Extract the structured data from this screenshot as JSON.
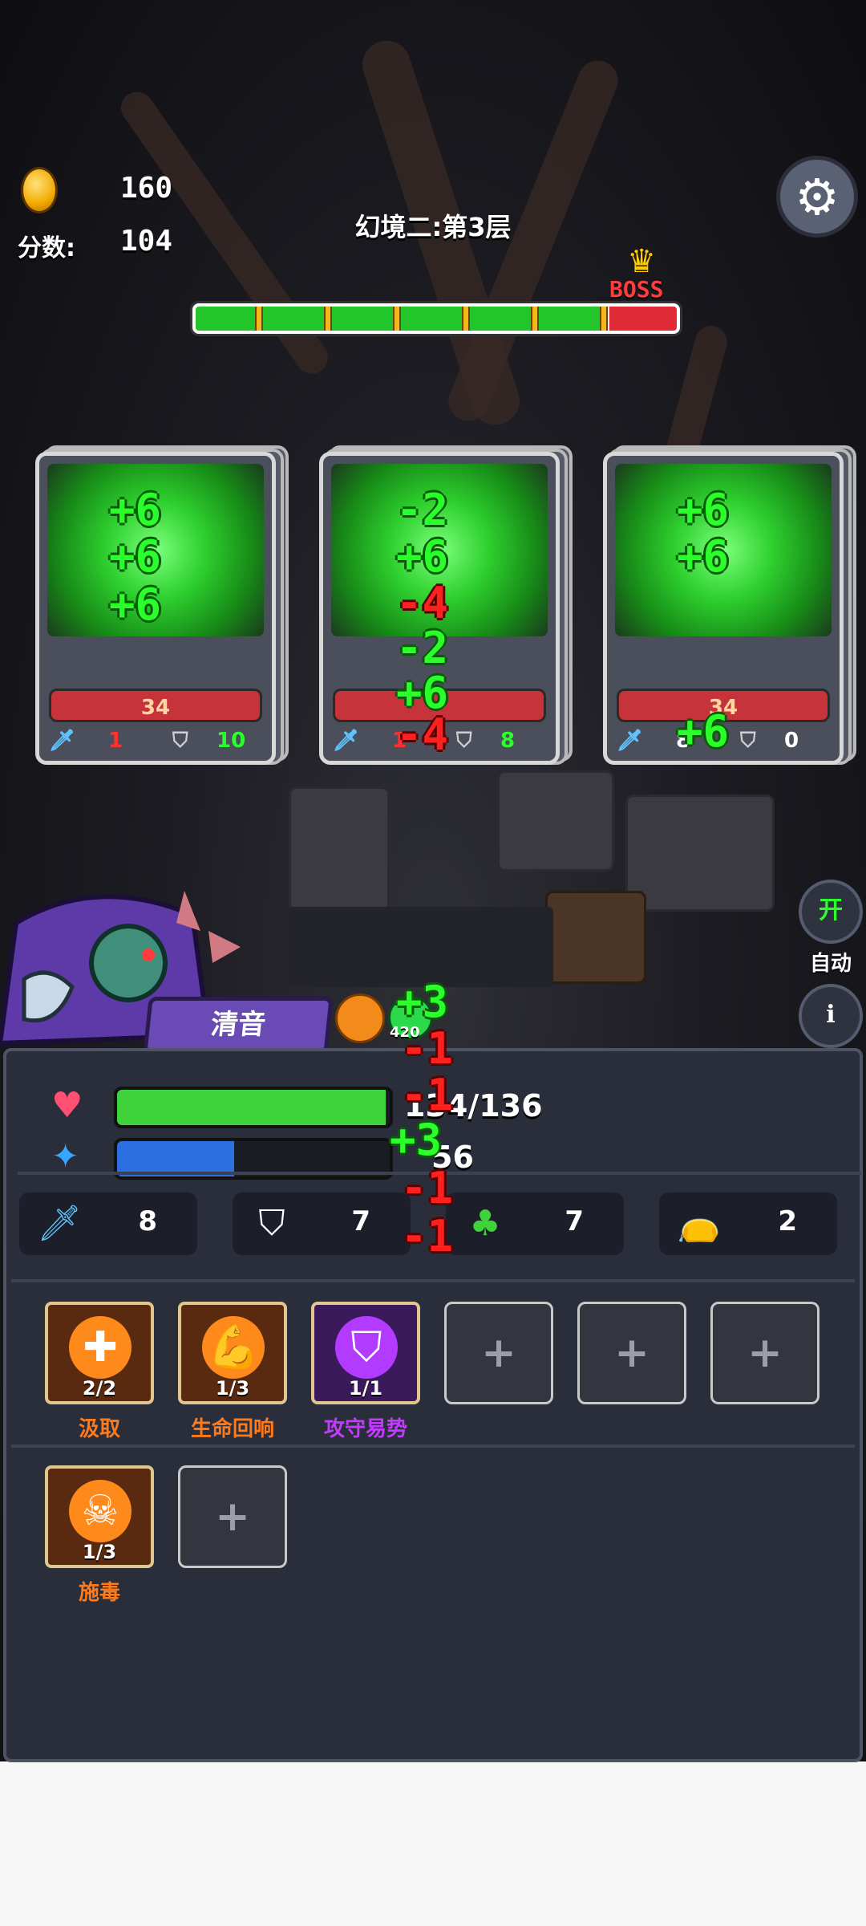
{
  "hud": {
    "coins": "160",
    "score_label": "分数:",
    "score": "104",
    "level_title": "幻境二:第3层",
    "boss_label": "BOSS",
    "stage_progress": 0.85,
    "icons": [
      "coin-icon",
      "gear-icon",
      "crown-icon"
    ]
  },
  "cards": [
    {
      "hp": "34",
      "attack": "1",
      "defense": "10",
      "effects": [
        "+6",
        "+6",
        "+6"
      ]
    },
    {
      "hp": "",
      "attack": "1",
      "defense": "8",
      "effects": [
        "-2",
        "+6",
        "-4",
        "-2",
        "+6",
        "-4"
      ]
    },
    {
      "hp": "34",
      "attack": "8",
      "defense": "0",
      "effects": [
        "+6",
        "+6",
        "+6"
      ]
    }
  ],
  "side_buttons": {
    "auto_toggle": "开",
    "auto_label": "自动",
    "info": "i"
  },
  "player": {
    "name": "清音",
    "buff_value": "420",
    "hp_text": "134/136",
    "hp_fraction": 0.985,
    "mana_text": "56",
    "mana_fraction": 0.43,
    "floating_numbers": [
      "+3",
      "-1",
      "-1",
      "+3",
      "-1",
      "-1"
    ]
  },
  "stats": [
    {
      "icon": "sword-icon",
      "value": "8"
    },
    {
      "icon": "shield-icon",
      "value": "7"
    },
    {
      "icon": "clover-icon",
      "value": "7"
    },
    {
      "icon": "money-bag-icon",
      "value": "2"
    }
  ],
  "skills_row1": [
    {
      "name": "汲取",
      "count": "2/2",
      "icon": "drain-icon"
    },
    {
      "name": "生命回响",
      "count": "1/3",
      "icon": "muscle-icon"
    },
    {
      "name": "攻守易势",
      "count": "1/1",
      "icon": "purple-shield-icon"
    }
  ],
  "skills_row2": [
    {
      "name": "施毒",
      "count": "1/3",
      "icon": "skull-icon"
    }
  ],
  "empty_slot": "+",
  "colors": {
    "hp_green": "#22c52a",
    "boss_red": "#e02a36",
    "mana_blue": "#2c6fe0",
    "skill_orange": "#ff7a1a",
    "skill_purple": "#c23bff"
  }
}
